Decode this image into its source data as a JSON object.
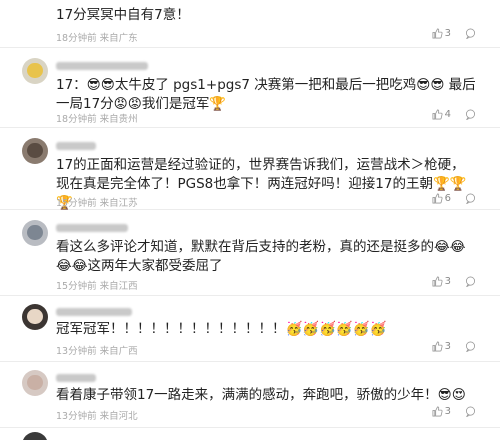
{
  "comments": [
    {
      "text": "17分冥冥中自有7意！",
      "meta": "18分钟前 来自广东",
      "likes": "3"
    },
    {
      "text": "17：😎😎太牛皮了 pgs1+pgs7 决赛第一把和最后一把吃鸡😎😎 最后一局17分😡😡我们是冠军🏆",
      "meta": "18分钟前 来自贵州",
      "likes": "4"
    },
    {
      "text": "17的正面和运营是经过验证的，世界赛告诉我们，运营战术＞枪硬，现在真是完全体了！PGS8也拿下！两连冠好吗！迎接17的王朝🏆🏆🏆",
      "meta": "15分钟前 来自江苏",
      "likes": "6"
    },
    {
      "text": "看这么多评论才知道，默默在背后支持的老粉，真的还是挺多的😂😂😂😂这两年大家都受委屈了",
      "meta": "15分钟前 来自江西",
      "likes": "3"
    },
    {
      "text": "冠军冠军！！！！！！！！！！！！！🥳🥳🥳🥳🥳🥳",
      "meta": "13分钟前 来自广西",
      "likes": "3"
    },
    {
      "text": "看着康子带领17一路走来，满满的感动，奔跑吧，骄傲的少年！😎😍",
      "meta": "13分钟前 来自河北",
      "likes": "3"
    }
  ],
  "colors": {
    "text": "#222222",
    "meta": "#aaaaaa",
    "divider": "#ececec"
  }
}
